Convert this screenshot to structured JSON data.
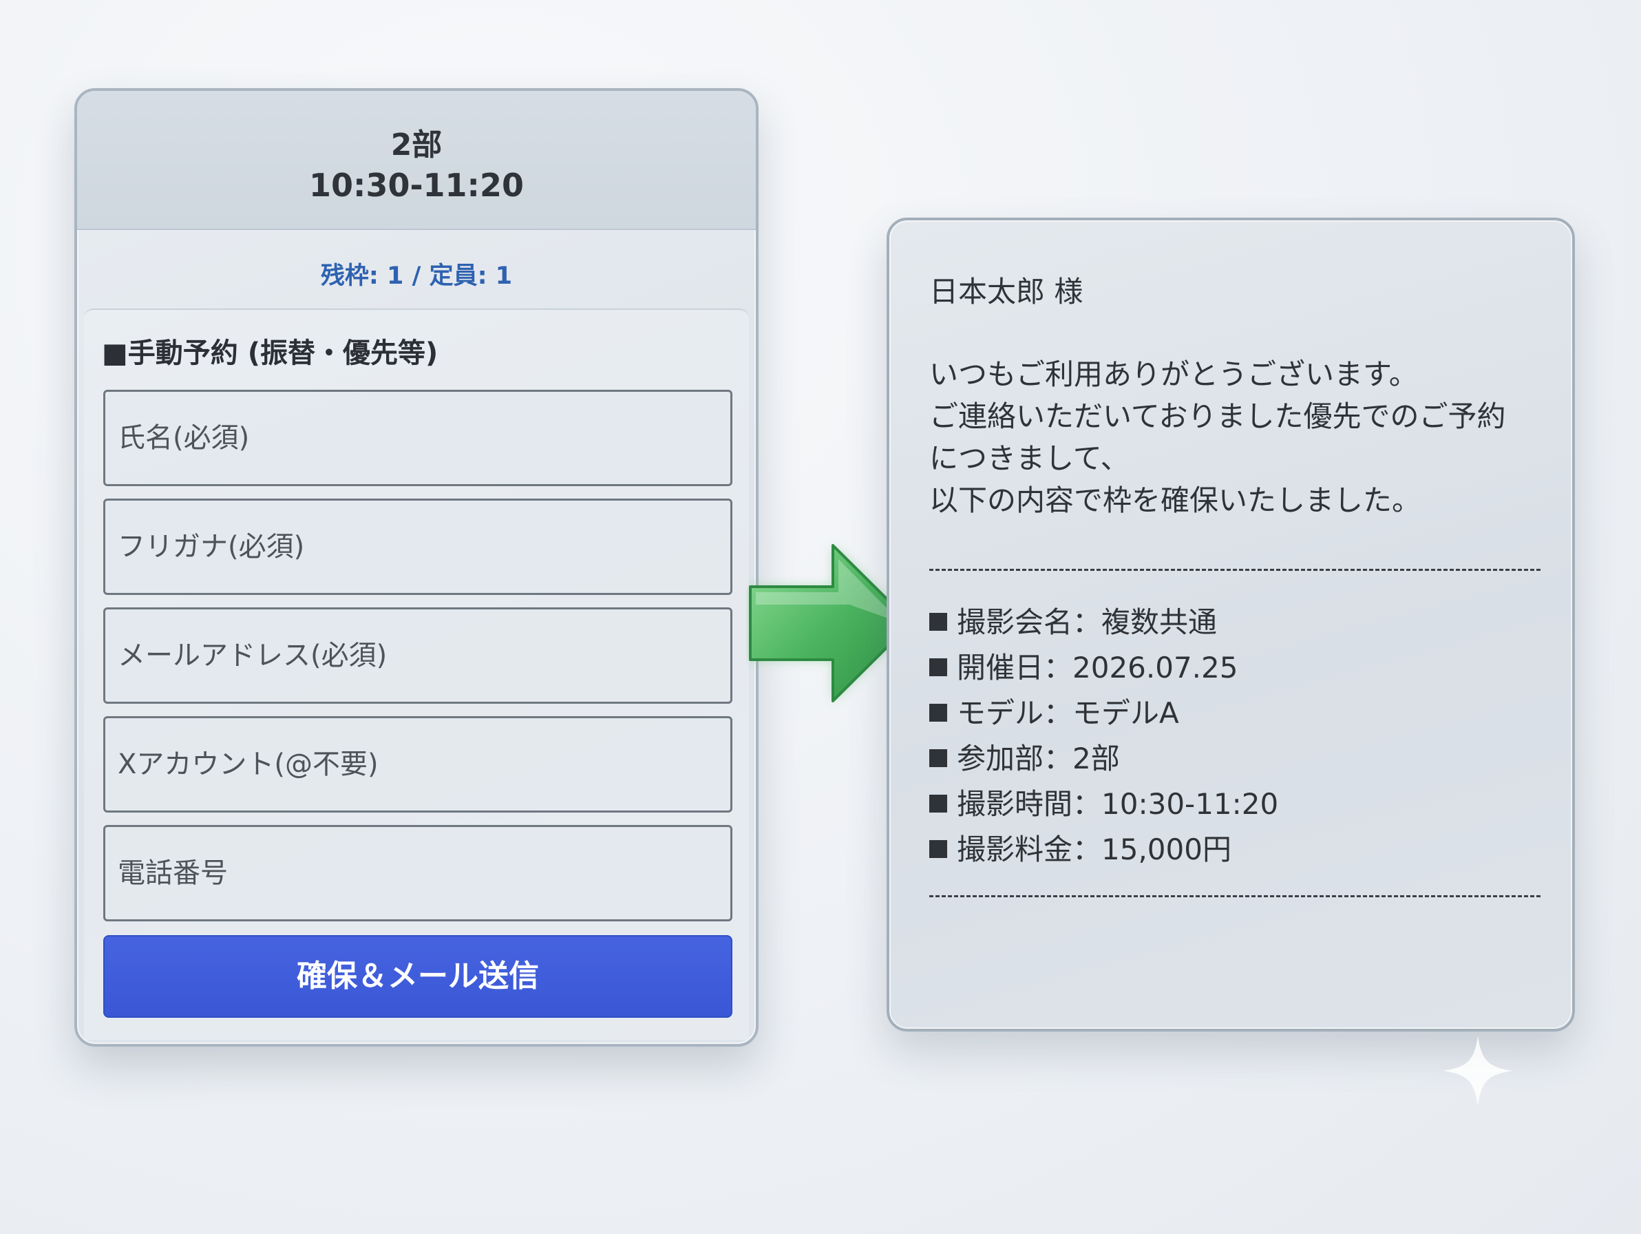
{
  "form": {
    "part": "2部",
    "time": "10:30-11:20",
    "slots": "残枠: 1 / 定員: 1",
    "section_title": "■手動予約 (振替・優先等)",
    "fields": {
      "name_placeholder": "氏名(必須)",
      "kana_placeholder": "フリガナ(必須)",
      "email_placeholder": "メールアドレス(必須)",
      "x_account_placeholder": "Xアカウント(@不要)",
      "phone_placeholder": "電話番号"
    },
    "submit_label": "確保＆メール送信"
  },
  "email": {
    "salutation": "日本太郎 様",
    "body": [
      "いつもご利用ありがとうございます。",
      "ご連絡いただいておりました優先でのご予約",
      "につきまして、",
      "以下の内容で枠を確保いたしました。"
    ],
    "details": [
      "撮影会名：複数共通",
      "開催日：2026.07.25",
      "モデル：モデルA",
      "参加部：2部",
      "撮影時間：10:30-11:20",
      "撮影料金：15,000円"
    ]
  },
  "icons": {
    "arrow": "arrow-right-icon",
    "sparkle": "sparkle-icon"
  },
  "colors": {
    "accent_blue": "#3a57d6",
    "slots_blue": "#2e62b0",
    "arrow_green": "#4cb560"
  }
}
